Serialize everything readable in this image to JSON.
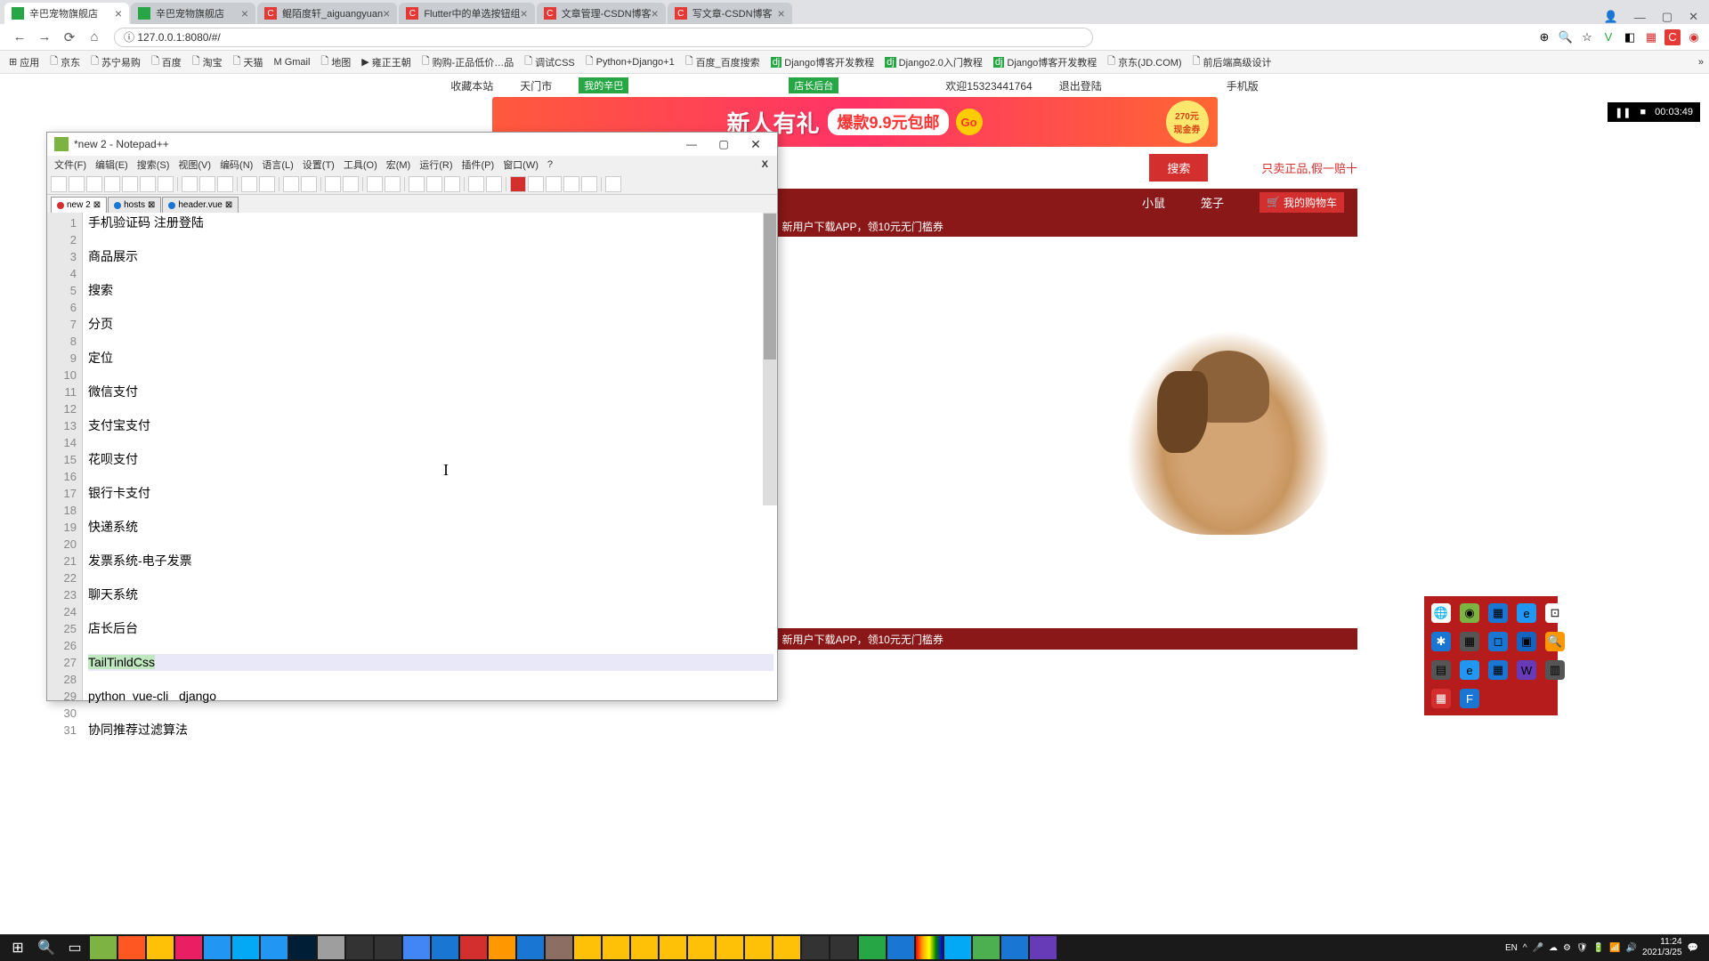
{
  "tabs": [
    {
      "title": "辛巴宠物旗舰店",
      "fav": "green"
    },
    {
      "title": "辛巴宠物旗舰店",
      "fav": "green"
    },
    {
      "title": "鲲陌度轩_aiguangyuan",
      "fav": "C"
    },
    {
      "title": "Flutter中的单选按钮组",
      "fav": "C"
    },
    {
      "title": "文章管理-CSDN博客",
      "fav": "C"
    },
    {
      "title": "写文章-CSDN博客",
      "fav": "C"
    }
  ],
  "url": "127.0.0.1:8080/#/",
  "bookmarks": [
    "应用",
    "京东",
    "苏宁易购",
    "百度",
    "淘宝",
    "天猫",
    "Gmail",
    "地图",
    "雍正王朝",
    "购购-正品低价…品",
    "调试CSS",
    "Python+Django+1",
    "百度_百度搜索",
    "Django博客开发教程",
    "Django2.0入门教程",
    "Django博客开发教程",
    "京东(JD.COM)",
    "前后端高级设计"
  ],
  "topnav": {
    "fav": "收藏本站",
    "city": "天门市",
    "mine": "我的辛巴",
    "admin": "店长后台",
    "welcome": "欢迎15323441764",
    "logout": "退出登陆",
    "mobile": "手机版"
  },
  "banner": {
    "t1": "新人有礼",
    "t2": "爆款9.9元包邮",
    "go": "Go",
    "coupon1": "270元",
    "coupon2": "现金券"
  },
  "search": {
    "btn": "搜索",
    "auth": "只卖正品,假一赔十"
  },
  "cats": {
    "c1": "小鼠",
    "c2": "笼子",
    "cart": "我的购物车"
  },
  "promo": "新用户下载APP，领10元无门槛券",
  "npp": {
    "title": "*new 2 - Notepad++",
    "menus": [
      "文件(F)",
      "编辑(E)",
      "搜索(S)",
      "视图(V)",
      "编码(N)",
      "语言(L)",
      "设置(T)",
      "工具(O)",
      "宏(M)",
      "运行(R)",
      "插件(P)",
      "窗口(W)",
      "?"
    ],
    "tabs": [
      {
        "name": "new 2",
        "mod": true
      },
      {
        "name": "hosts",
        "mod": false
      },
      {
        "name": "header.vue",
        "mod": false
      }
    ],
    "lines": [
      "手机验证码 注册登陆",
      "",
      "商品展示",
      "",
      "搜索",
      "",
      "分页",
      "",
      "定位",
      "",
      "微信支付",
      "",
      "支付宝支付",
      "",
      "花呗支付",
      "",
      "银行卡支付",
      "",
      "快递系统",
      "",
      "发票系统-电子发票",
      "",
      "聊天系统",
      "",
      "店长后台",
      "",
      "TailTinldCss",
      "",
      "python  vue-cli   django",
      "",
      "协同推荐过滤算法"
    ],
    "highlight_line": 27
  },
  "recorder": {
    "time": "00:03:49"
  },
  "clock": {
    "time": "11:24",
    "date": "2021/3/25"
  },
  "icon_phone": "📱"
}
